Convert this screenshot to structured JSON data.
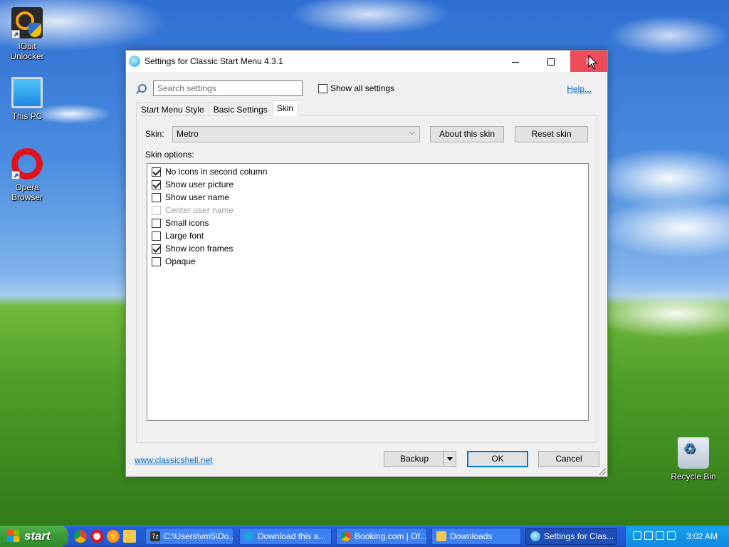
{
  "desktop": {
    "icons": [
      {
        "label_line1": "IObit",
        "label_line2": "Unlocker"
      },
      {
        "label_line1": "This PC",
        "label_line2": ""
      },
      {
        "label_line1": "Opera",
        "label_line2": "Browser"
      },
      {
        "label_line1": "Recycle Bin",
        "label_line2": ""
      }
    ]
  },
  "window": {
    "title": "Settings for Classic Start Menu 4.3.1",
    "search": {
      "placeholder": "Search settings",
      "value": ""
    },
    "show_all_settings": {
      "label": "Show all settings",
      "checked": false
    },
    "help_link": "Help...",
    "tabs": [
      {
        "label": "Start Menu Style",
        "active": false
      },
      {
        "label": "Basic Settings",
        "active": false
      },
      {
        "label": "Skin",
        "active": true
      }
    ],
    "skin": {
      "label": "Skin:",
      "selected": "Metro",
      "about_button": "About this skin",
      "reset_button": "Reset skin"
    },
    "skin_options_label": "Skin options:",
    "options": [
      {
        "label": "No icons in second column",
        "checked": true,
        "disabled": false
      },
      {
        "label": "Show user picture",
        "checked": true,
        "disabled": false
      },
      {
        "label": "Show user name",
        "checked": false,
        "disabled": false
      },
      {
        "label": "Center user name",
        "checked": false,
        "disabled": true
      },
      {
        "label": "Small icons",
        "checked": false,
        "disabled": false
      },
      {
        "label": "Large font",
        "checked": false,
        "disabled": false
      },
      {
        "label": "Show icon frames",
        "checked": true,
        "disabled": false
      },
      {
        "label": "Opaque",
        "checked": false,
        "disabled": false
      }
    ],
    "footer": {
      "link": "www.classicshell.net",
      "backup": "Backup",
      "ok": "OK",
      "cancel": "Cancel"
    }
  },
  "taskbar": {
    "start": "start",
    "tasks": [
      {
        "label": "C:\\Users\\vm5\\Do...",
        "icon": "7zip-icon",
        "color": "#333333"
      },
      {
        "label": "Download this a...",
        "icon": "edge-icon",
        "color": "#1fa3e0"
      },
      {
        "label": "Booking.com | Of...",
        "icon": "chrome-icon",
        "color": "#e8453c"
      },
      {
        "label": "Downloads",
        "icon": "folder-icon",
        "color": "#f2c94c"
      },
      {
        "label": "Settings for Clas...",
        "icon": "classic-shell-icon",
        "color": "#4fc3f7"
      }
    ],
    "clock": "3:02 AM"
  },
  "colors": {
    "close_hover": "#e81123",
    "link": "#0066cc",
    "default_button_border": "#0078d7",
    "start_green": "#3c9a36",
    "taskbar_blue": "#245edb"
  }
}
